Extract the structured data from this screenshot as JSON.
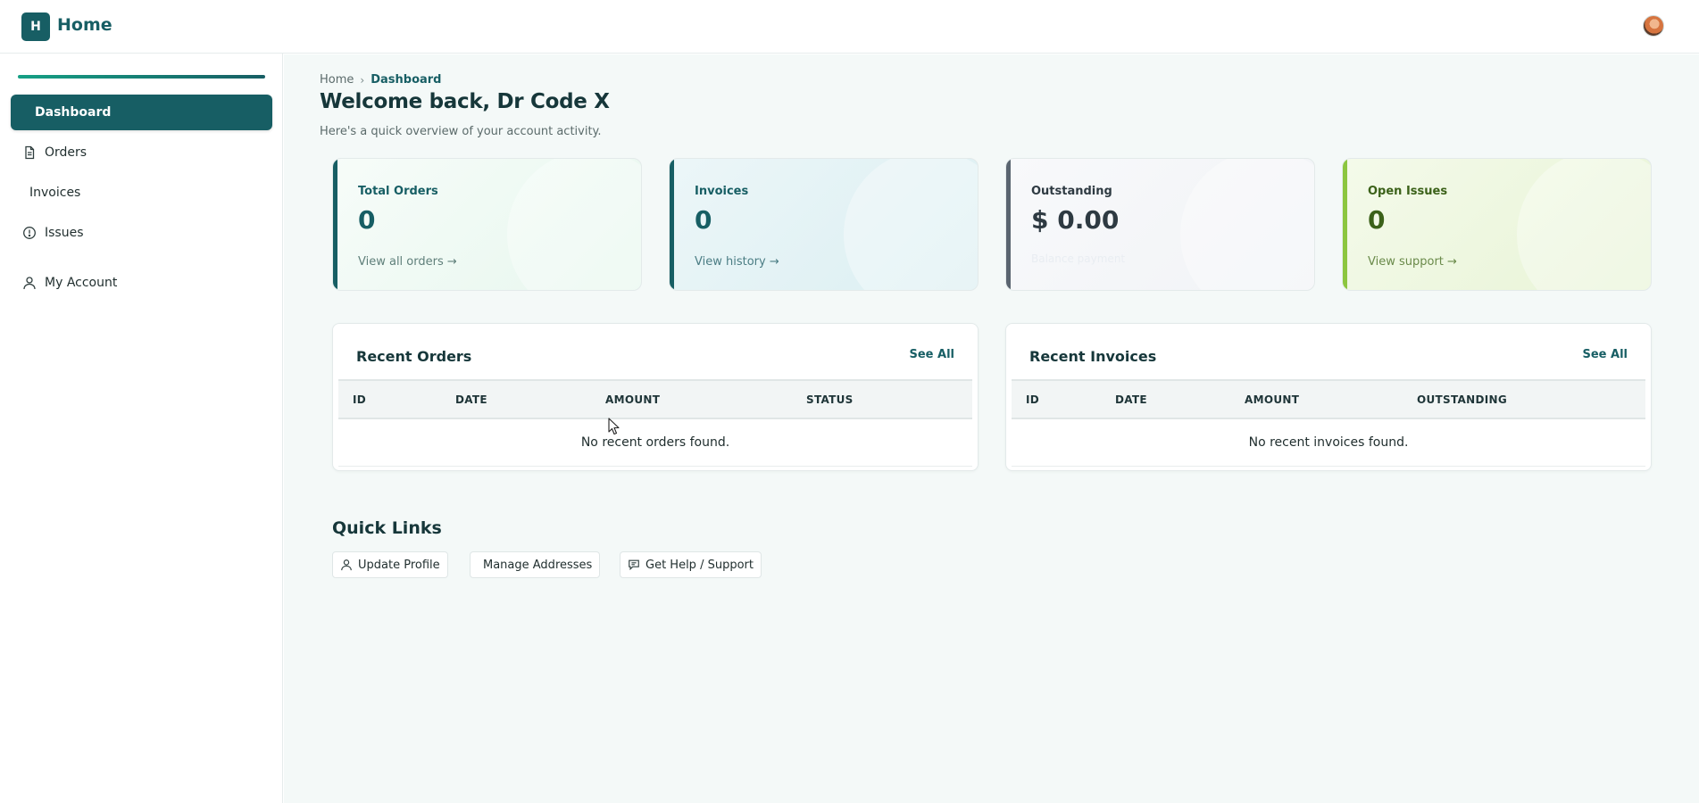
{
  "header": {
    "logo_letter": "H",
    "title": "Home",
    "avatar_icon": "user-avatar"
  },
  "sidebar": {
    "items": [
      {
        "label": "Dashboard",
        "icon": "",
        "active": true
      },
      {
        "label": "Orders",
        "icon": "document-icon"
      },
      {
        "label": "Invoices",
        "icon": ""
      },
      {
        "label": "Issues",
        "icon": "alert-circle-icon"
      },
      {
        "label": "My Account",
        "icon": "user-icon"
      }
    ]
  },
  "breadcrumb": {
    "home": "Home",
    "current": "Dashboard"
  },
  "page": {
    "title": "Welcome back, Dr Code X",
    "subtitle": "Here's a quick overview of your account activity."
  },
  "cards": [
    {
      "label": "Total Orders",
      "value": "0",
      "link": "View all orders →",
      "accent": "#175e64"
    },
    {
      "label": "Invoices",
      "value": "0",
      "link": "View history →",
      "accent": "#175e64"
    },
    {
      "label": "Outstanding",
      "value": "$ 0.00",
      "link": "Balance payment",
      "accent": "#5a6570"
    },
    {
      "label": "Open Issues",
      "value": "0",
      "link": "View support →",
      "accent": "#8cc63f"
    }
  ],
  "recent_orders": {
    "title": "Recent Orders",
    "see_all": "See All",
    "columns": [
      "ID",
      "DATE",
      "AMOUNT",
      "STATUS"
    ],
    "empty": "No recent orders found."
  },
  "recent_invoices": {
    "title": "Recent Invoices",
    "see_all": "See All",
    "columns": [
      "ID",
      "DATE",
      "AMOUNT",
      "OUTSTANDING"
    ],
    "empty": "No recent invoices found."
  },
  "quick_links": {
    "title": "Quick Links",
    "items": [
      {
        "label": "Update Profile",
        "icon": "user-icon"
      },
      {
        "label": "Manage Addresses",
        "icon": ""
      },
      {
        "label": "Get Help / Support",
        "icon": "chat-icon"
      }
    ]
  }
}
